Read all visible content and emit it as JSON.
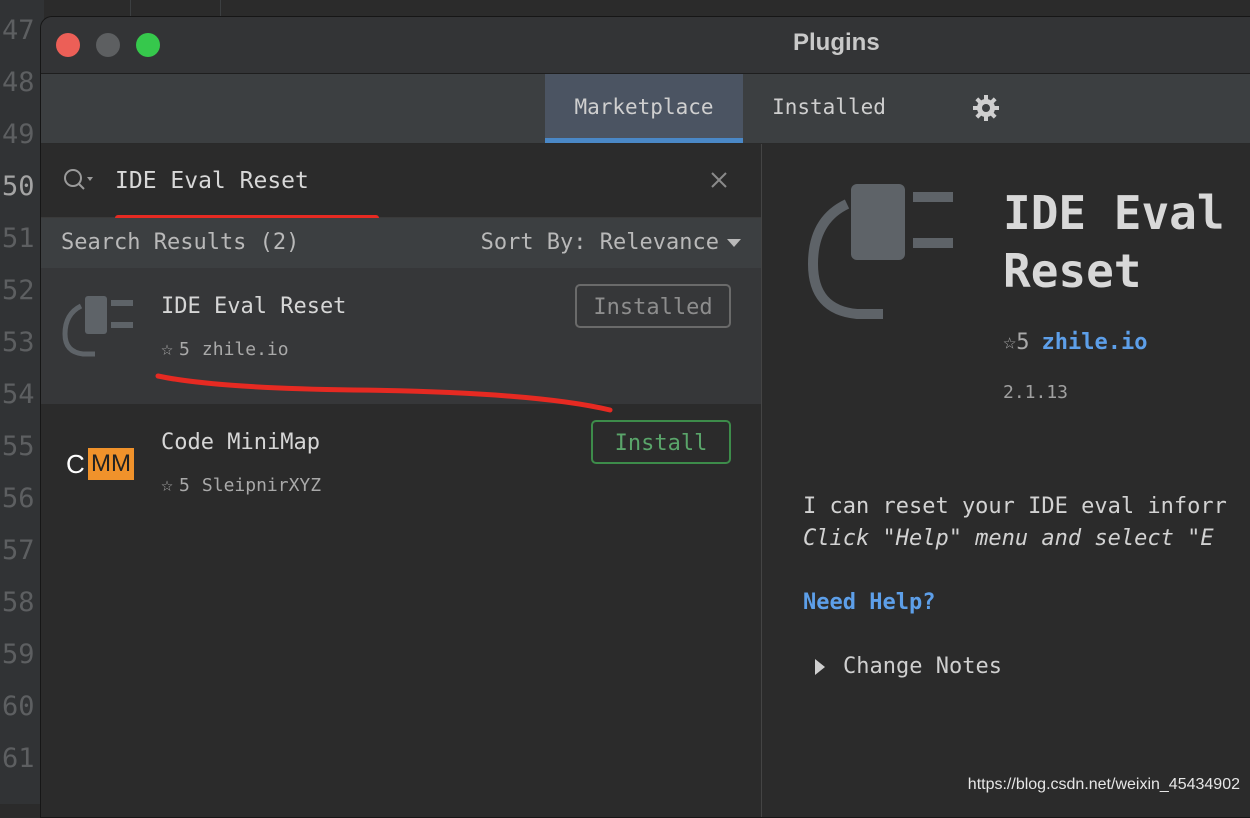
{
  "editor": {
    "line_numbers": [
      "47",
      "48",
      "49",
      "50",
      "51",
      "52",
      "53",
      "54",
      "55",
      "56",
      "57",
      "58",
      "59",
      "60",
      "61"
    ],
    "current_line": "50"
  },
  "window": {
    "title": "Plugins"
  },
  "tabs": [
    {
      "label": "Marketplace",
      "active": true
    },
    {
      "label": "Installed",
      "active": false
    }
  ],
  "search": {
    "value": "IDE Eval Reset"
  },
  "results": {
    "count_label": "Search Results (2)",
    "sort_label": "Sort By: Relevance"
  },
  "plugins": [
    {
      "name": "IDE Eval Reset",
      "rating": "5",
      "vendor": "zhile.io",
      "button": "Installed",
      "icon": "plug-icon"
    },
    {
      "name": "Code MiniMap",
      "rating": "5",
      "vendor": "SleipnirXYZ",
      "button": "Install",
      "icon": "cmm-logo",
      "logo_c": "C",
      "logo_mm": "MM"
    }
  ],
  "detail": {
    "name": "IDE Eval\nReset",
    "rating": "5",
    "vendor": "zhile.io",
    "version": "2.1.13",
    "description_line1": "I can reset your IDE eval inforr",
    "description_line2": "Click \"Help\" menu and select \"E",
    "help_link": "Need Help?",
    "change_notes": "Change Notes"
  },
  "watermark": "https://blog.csdn.net/weixin_45434902",
  "colors": {
    "accent_blue": "#4a88c7",
    "link_blue": "#5d9fe9",
    "install_green": "#3d8c4a",
    "annotation_red": "#e62a22"
  }
}
